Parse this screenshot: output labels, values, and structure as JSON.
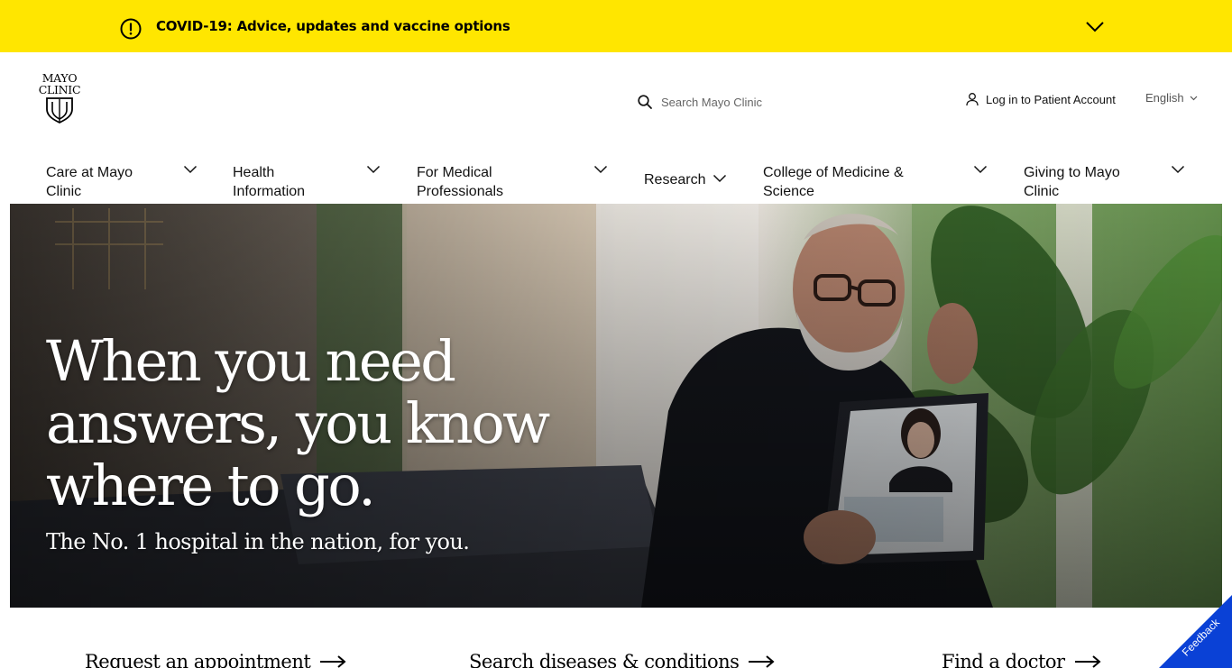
{
  "covid_banner": {
    "text": "COVID-19: Advice, updates and vaccine options",
    "background": "#ffe600"
  },
  "header": {
    "logo_line1": "MAYO",
    "logo_line2": "CLINIC",
    "search_placeholder": "Search Mayo Clinic",
    "login_label": "Log in to Patient Account",
    "language_label": "English"
  },
  "nav": {
    "items": [
      {
        "label_line1": "Care at Mayo",
        "label_line2": "Clinic"
      },
      {
        "label_line1": "Health",
        "label_line2": "Information"
      },
      {
        "label_line1": "For Medical",
        "label_line2": "Professionals"
      },
      {
        "label_line1": "Research",
        "label_line2": ""
      },
      {
        "label_line1": "College of Medicine &",
        "label_line2": "Science"
      },
      {
        "label_line1": "Giving to Mayo",
        "label_line2": "Clinic"
      }
    ]
  },
  "hero": {
    "headline_line1": "When you need",
    "headline_line2": "answers, you know",
    "headline_line3": "where to go.",
    "subheadline": "The No. 1 hospital in the nation, for you."
  },
  "quick_links": [
    {
      "label": "Request an appointment"
    },
    {
      "label": "Search diseases & conditions"
    },
    {
      "label": "Find a doctor"
    }
  ],
  "feedback": {
    "label": "Feedback",
    "background": "#0a41d6"
  },
  "icons": {
    "alert": "alert-circle-icon",
    "chevron": "chevron-down-icon",
    "search": "search-icon",
    "user": "user-icon",
    "arrow": "arrow-right-icon"
  }
}
